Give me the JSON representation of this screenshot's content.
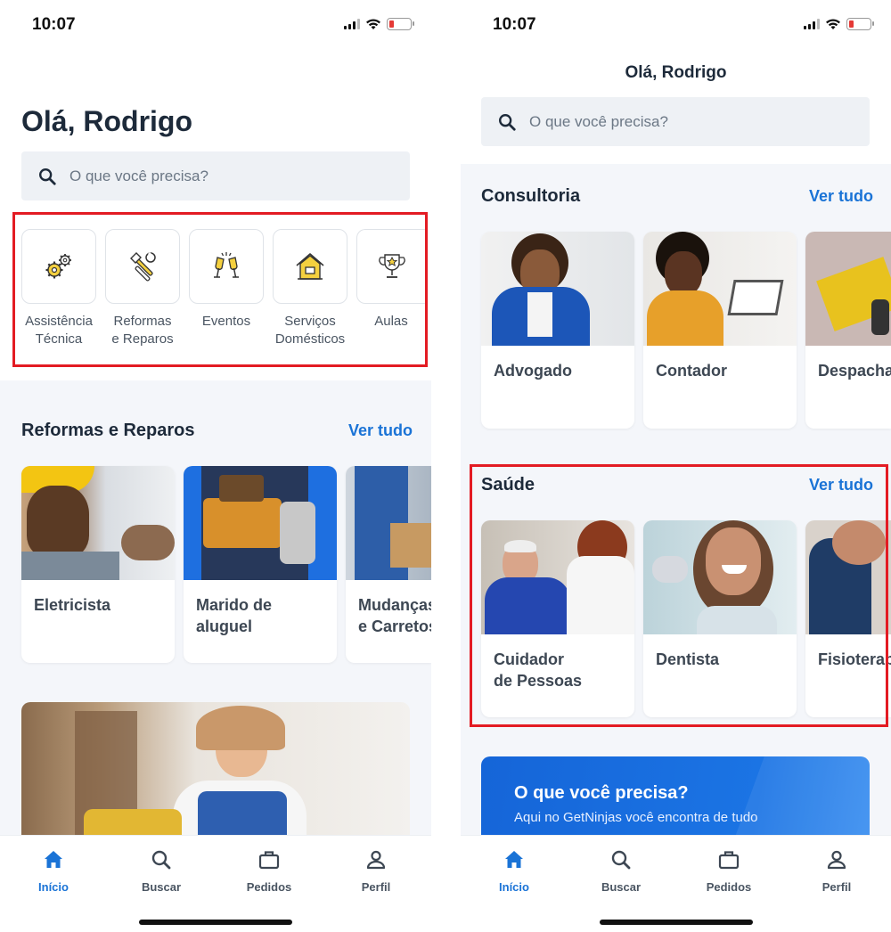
{
  "left": {
    "status": {
      "time": "10:07"
    },
    "greeting": "Olá, Rodrigo",
    "search": {
      "placeholder": "O que você precisa?"
    },
    "categories": [
      {
        "label": "Assistência\nTécnica",
        "icon": "gears-icon"
      },
      {
        "label": "Reformas\ne Reparos",
        "icon": "tools-icon"
      },
      {
        "label": "Eventos",
        "icon": "champagne-icon"
      },
      {
        "label": "Serviços\nDomésticos",
        "icon": "house-icon"
      },
      {
        "label": "Aulas",
        "icon": "trophy-icon"
      }
    ],
    "section": {
      "title": "Reformas e Reparos",
      "ver_tudo": "Ver tudo",
      "cards": [
        {
          "title": "Eletricista"
        },
        {
          "title": "Marido de aluguel"
        },
        {
          "title": "Mudanças\ne Carretos"
        }
      ]
    }
  },
  "right": {
    "status": {
      "time": "10:07"
    },
    "greeting": "Olá, Rodrigo",
    "search": {
      "placeholder": "O que você precisa?"
    },
    "consultoria": {
      "title": "Consultoria",
      "ver_tudo": "Ver tudo",
      "cards": [
        {
          "title": "Advogado"
        },
        {
          "title": "Contador"
        },
        {
          "title": "Despachante"
        }
      ]
    },
    "saude": {
      "title": "Saúde",
      "ver_tudo": "Ver tudo",
      "cards": [
        {
          "title": "Cuidador\nde Pessoas"
        },
        {
          "title": "Dentista"
        },
        {
          "title": "Fisioterapeuta"
        }
      ]
    },
    "promo": {
      "title": "O que você precisa?",
      "text": "Aqui no GetNinjas você encontra de tudo"
    }
  },
  "nav": {
    "items": [
      {
        "label": "Início",
        "icon": "home-icon",
        "active": true
      },
      {
        "label": "Buscar",
        "icon": "search-icon",
        "active": false
      },
      {
        "label": "Pedidos",
        "icon": "briefcase-icon",
        "active": false
      },
      {
        "label": "Perfil",
        "icon": "person-icon",
        "active": false
      }
    ]
  },
  "colors": {
    "accent": "#1a73d6",
    "highlight": "#e31b23",
    "battery_low": "#e53935"
  }
}
